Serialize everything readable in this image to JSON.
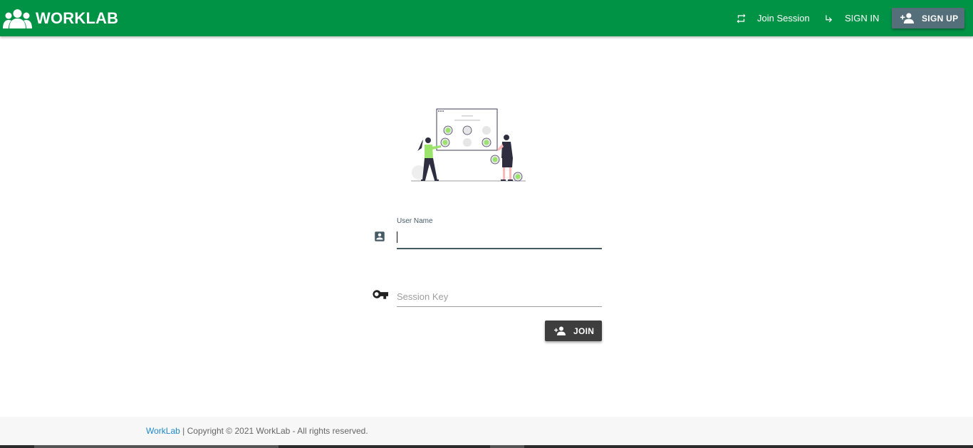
{
  "navbar": {
    "brand": "WORKLAB",
    "join_session_label": "Join Session",
    "sign_in_label": "SIGN IN",
    "sign_up_label": "SIGN UP",
    "bg_color": "#009245",
    "signup_color": "#546e7a",
    "icons": {
      "brand": "group-icon",
      "join_session": "repeat-icon",
      "sign_in": "subdirectory-arrow-right-icon",
      "sign_up": "person-add-icon"
    }
  },
  "form": {
    "username_label": "User Name",
    "username_value": "",
    "session_key_placeholder": "Session Key",
    "session_key_value": "",
    "join_label": "JOIN",
    "icons": {
      "username": "account-box-icon",
      "session_key": "key-icon",
      "join": "person-add-icon"
    }
  },
  "footer": {
    "link_text": "WorkLab",
    "copyright": " | Copyright © 2021 WorkLab - All rights reserved."
  }
}
